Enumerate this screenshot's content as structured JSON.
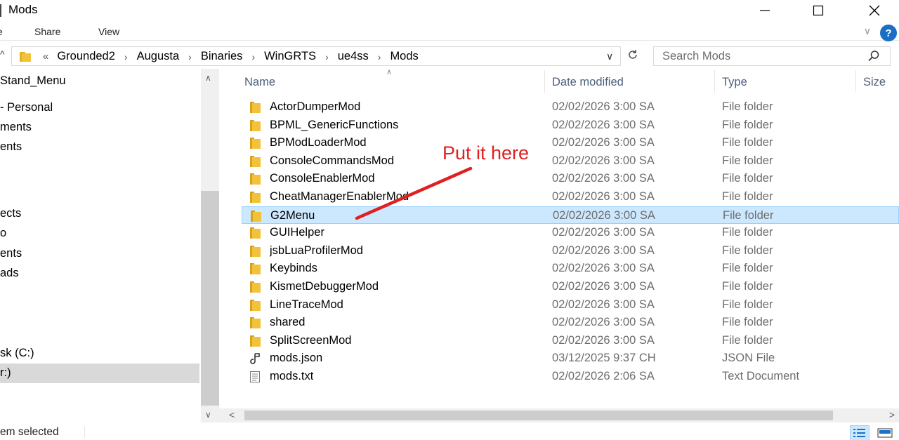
{
  "window": {
    "title": "Mods"
  },
  "ribbon": {
    "tabs": [
      "Share",
      "View"
    ],
    "help": "?"
  },
  "address": {
    "overflow": "«",
    "crumbs": [
      "Grounded2",
      "Augusta",
      "Binaries",
      "WinGRTS",
      "ue4ss",
      "Mods"
    ]
  },
  "search": {
    "placeholder": "Search Mods"
  },
  "nav": {
    "items": [
      {
        "label": "Stand_Menu",
        "selected": false
      },
      {
        "label": "- Personal",
        "selected": false
      },
      {
        "label": "ments",
        "selected": false
      },
      {
        "label": "ents",
        "selected": false
      },
      {
        "label": "ects",
        "selected": false
      },
      {
        "label": "ents",
        "selected": false
      },
      {
        "label": "ads",
        "selected": false
      },
      {
        "label": "sk (C:)",
        "selected": false
      },
      {
        "label": "r:)",
        "selected": true
      }
    ]
  },
  "columns": {
    "name": "Name",
    "date": "Date modified",
    "type": "Type",
    "size": "Size"
  },
  "files": [
    {
      "name": "ActorDumperMod",
      "date": "02/02/2026 3:00 SA",
      "type": "File folder",
      "icon": "folder-icon",
      "selected": false
    },
    {
      "name": "BPML_GenericFunctions",
      "date": "02/02/2026 3:00 SA",
      "type": "File folder",
      "icon": "folder-icon",
      "selected": false
    },
    {
      "name": "BPModLoaderMod",
      "date": "02/02/2026 3:00 SA",
      "type": "File folder",
      "icon": "folder-icon",
      "selected": false
    },
    {
      "name": "ConsoleCommandsMod",
      "date": "02/02/2026 3:00 SA",
      "type": "File folder",
      "icon": "folder-icon",
      "selected": false
    },
    {
      "name": "ConsoleEnablerMod",
      "date": "02/02/2026 3:00 SA",
      "type": "File folder",
      "icon": "folder-icon",
      "selected": false
    },
    {
      "name": "CheatManagerEnablerMod",
      "date": "02/02/2026 3:00 SA",
      "type": "File folder",
      "icon": "folder-icon",
      "selected": false
    },
    {
      "name": "G2Menu",
      "date": "02/02/2026 3:00 SA",
      "type": "File folder",
      "icon": "folder-icon",
      "selected": true
    },
    {
      "name": "GUIHelper",
      "date": "02/02/2026 3:00 SA",
      "type": "File folder",
      "icon": "folder-icon",
      "selected": false
    },
    {
      "name": "jsbLuaProfilerMod",
      "date": "02/02/2026 3:00 SA",
      "type": "File folder",
      "icon": "folder-icon",
      "selected": false
    },
    {
      "name": "Keybinds",
      "date": "02/02/2026 3:00 SA",
      "type": "File folder",
      "icon": "folder-icon",
      "selected": false
    },
    {
      "name": "KismetDebuggerMod",
      "date": "02/02/2026 3:00 SA",
      "type": "File folder",
      "icon": "folder-icon",
      "selected": false
    },
    {
      "name": "LineTraceMod",
      "date": "02/02/2026 3:00 SA",
      "type": "File folder",
      "icon": "folder-icon",
      "selected": false
    },
    {
      "name": "shared",
      "date": "02/02/2026 3:00 SA",
      "type": "File folder",
      "icon": "folder-icon",
      "selected": false
    },
    {
      "name": "SplitScreenMod",
      "date": "02/02/2026 3:00 SA",
      "type": "File folder",
      "icon": "folder-icon",
      "selected": false
    },
    {
      "name": "mods.json",
      "date": "03/12/2025 9:37 CH",
      "type": "JSON File",
      "icon": "json-file-icon",
      "selected": false
    },
    {
      "name": "mods.txt",
      "date": "02/02/2026 2:06 SA",
      "type": "Text Document",
      "icon": "text-file-icon",
      "selected": false
    }
  ],
  "status": {
    "text": "em selected"
  },
  "annotation": {
    "text": "Put it here",
    "color": "#e02020"
  },
  "colors": {
    "folder": "#f2c23a",
    "selection_bg": "#cce8ff",
    "selection_border": "#99d1ff",
    "header_text": "#4c607a",
    "help": "#1a6fc4"
  }
}
